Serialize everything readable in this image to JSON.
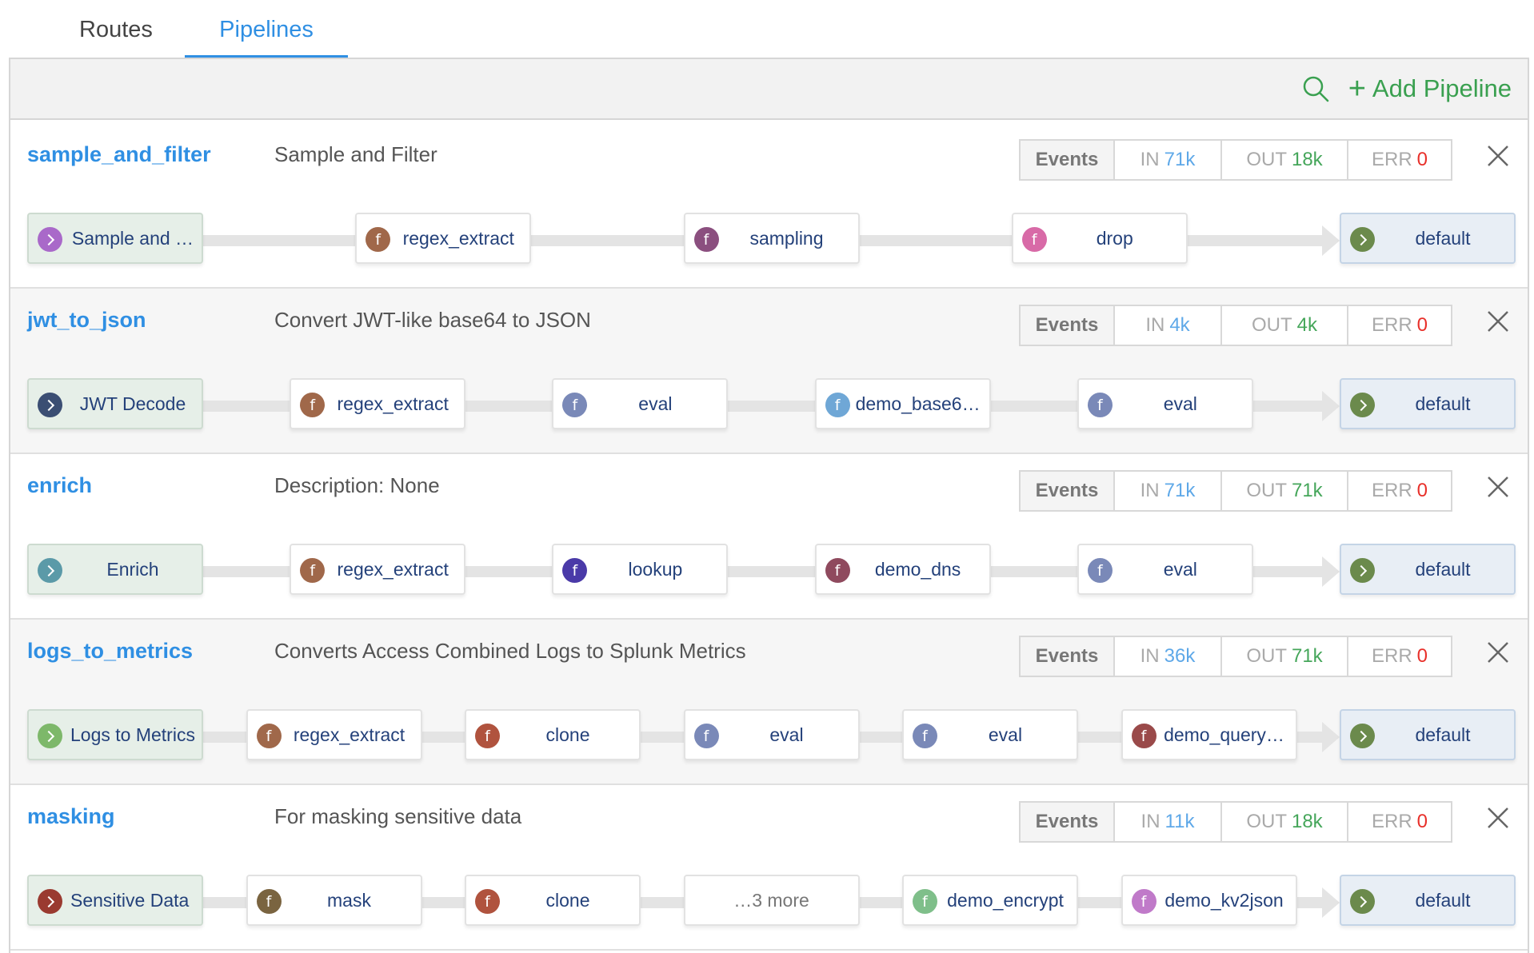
{
  "tabs": [
    {
      "label": "Routes",
      "active": false
    },
    {
      "label": "Pipelines",
      "active": true
    }
  ],
  "toolbar": {
    "add_label": "Add Pipeline",
    "search_icon": "search-icon"
  },
  "events_labels": {
    "events": "Events",
    "in": "IN",
    "out": "OUT",
    "err": "ERR"
  },
  "colors": {
    "accent": "#2f8fe3",
    "green": "#3aa050",
    "error": "#e8302a"
  },
  "pipelines": [
    {
      "id": "sample_and_filter",
      "description": "Sample and Filter",
      "in": "71k",
      "out": "18k",
      "err": "0",
      "route": {
        "label": "Sample and …",
        "color": "#a969c9"
      },
      "functions": [
        {
          "label": "regex_extract",
          "color": "#a0684a"
        },
        {
          "label": "sampling",
          "color": "#8b4f7f"
        },
        {
          "label": "drop",
          "color": "#d86aa7"
        }
      ],
      "destination": {
        "label": "default",
        "color": "#6b8a4c"
      }
    },
    {
      "id": "jwt_to_json",
      "description": "Convert JWT-like base64 to JSON",
      "in": "4k",
      "out": "4k",
      "err": "0",
      "route": {
        "label": "JWT Decode",
        "color": "#3b4e73"
      },
      "functions": [
        {
          "label": "regex_extract",
          "color": "#a0684a"
        },
        {
          "label": "eval",
          "color": "#7a89b8"
        },
        {
          "label": "demo_base6…",
          "color": "#6fa7d6"
        },
        {
          "label": "eval",
          "color": "#7a89b8"
        }
      ],
      "destination": {
        "label": "default",
        "color": "#6b8a4c"
      }
    },
    {
      "id": "enrich",
      "description": "Description: None",
      "in": "71k",
      "out": "71k",
      "err": "0",
      "route": {
        "label": "Enrich",
        "color": "#5b9aa8"
      },
      "functions": [
        {
          "label": "regex_extract",
          "color": "#a0684a"
        },
        {
          "label": "lookup",
          "color": "#4a3aa8"
        },
        {
          "label": "demo_dns",
          "color": "#8f4a5e"
        },
        {
          "label": "eval",
          "color": "#7a89b8"
        }
      ],
      "destination": {
        "label": "default",
        "color": "#6b8a4c"
      }
    },
    {
      "id": "logs_to_metrics",
      "description": "Converts Access Combined Logs to Splunk Metrics",
      "in": "36k",
      "out": "71k",
      "err": "0",
      "route": {
        "label": "Logs to Metrics",
        "color": "#7db86a"
      },
      "functions": [
        {
          "label": "regex_extract",
          "color": "#a0684a"
        },
        {
          "label": "clone",
          "color": "#b0533e"
        },
        {
          "label": "eval",
          "color": "#7a89b8"
        },
        {
          "label": "eval",
          "color": "#7a89b8"
        },
        {
          "label": "demo_query…",
          "color": "#9a4a4a"
        }
      ],
      "destination": {
        "label": "default",
        "color": "#6b8a4c"
      }
    },
    {
      "id": "masking",
      "description": "For masking sensitive data",
      "in": "11k",
      "out": "18k",
      "err": "0",
      "route": {
        "label": "Sensitive Data",
        "color": "#9a3a30"
      },
      "functions": [
        {
          "label": "mask",
          "color": "#7a6440"
        },
        {
          "label": "clone",
          "color": "#b0533e"
        },
        {
          "label": "…3 more",
          "color": "",
          "more": true
        },
        {
          "label": "demo_encrypt",
          "color": "#7fbf8a"
        },
        {
          "label": "demo_kv2json",
          "color": "#c07ac9"
        }
      ],
      "destination": {
        "label": "default",
        "color": "#6b8a4c"
      }
    }
  ]
}
